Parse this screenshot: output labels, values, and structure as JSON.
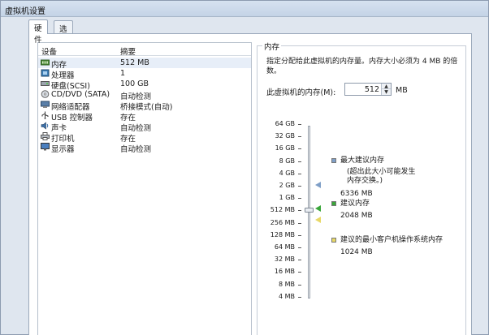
{
  "window": {
    "title": "虚拟机设置"
  },
  "tabs": [
    {
      "label": "硬件",
      "active": true
    },
    {
      "label": "选项",
      "active": false
    }
  ],
  "device_list": {
    "columns": {
      "device": "设备",
      "summary": "摘要"
    },
    "rows": [
      {
        "name": "内存",
        "summary": "512 MB",
        "icon": "memory-icon",
        "selected": true
      },
      {
        "name": "处理器",
        "summary": "1",
        "icon": "processor-icon"
      },
      {
        "name": "硬盘(SCSI)",
        "summary": "100 GB",
        "icon": "hard-disk-icon"
      },
      {
        "name": "CD/DVD (SATA)",
        "summary": "自动检测",
        "icon": "cd-dvd-icon"
      },
      {
        "name": "网络适配器",
        "summary": "桥接模式(自动)",
        "icon": "network-adapter-icon"
      },
      {
        "name": "USB 控制器",
        "summary": "存在",
        "icon": "usb-icon"
      },
      {
        "name": "声卡",
        "summary": "自动检测",
        "icon": "sound-card-icon"
      },
      {
        "name": "打印机",
        "summary": "存在",
        "icon": "printer-icon"
      },
      {
        "name": "显示器",
        "summary": "自动检测",
        "icon": "display-icon"
      }
    ]
  },
  "memory": {
    "group_title": "内存",
    "description": "指定分配给此虚拟机的内存量。内存大小必须为 4 MB 的倍数。",
    "field_label": "此虚拟机的内存(M):",
    "value": "512",
    "unit": "MB",
    "scale": [
      "64 GB",
      "32 GB",
      "16 GB",
      "8 GB",
      "4 GB",
      "2 GB",
      "1 GB",
      "512 MB",
      "256 MB",
      "128 MB",
      "64 MB",
      "32 MB",
      "16 MB",
      "8 MB",
      "4 MB"
    ],
    "slider_value": "512 MB",
    "legend": {
      "max_recommended": {
        "label": "最大建议内存",
        "note": "(超出此大小可能发生内存交换。)",
        "value": "6336 MB",
        "color": "#7f9fc7"
      },
      "recommended": {
        "label": "建议内存",
        "value": "2048 MB",
        "color": "#3aa63a"
      },
      "guest_min": {
        "label": "建议的最小客户机操作系统内存",
        "value": "1024 MB",
        "color": "#e8d866"
      }
    }
  }
}
